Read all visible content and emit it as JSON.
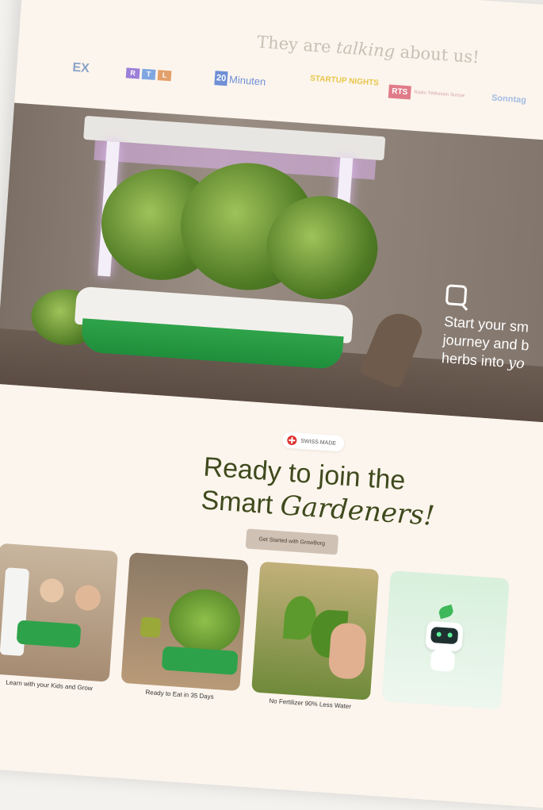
{
  "press": {
    "title_pre": "They are",
    "title_italic": "talking",
    "title_post": "about us!",
    "logos": {
      "ex": "EX",
      "rtl": [
        "R",
        "T",
        "L"
      ],
      "minuten_num": "20",
      "minuten_word": "Minuten",
      "startup": "STARTUP NIGHTS",
      "rts": "RTS",
      "rts_sub": "Radio Télévision Suisse",
      "sonntag": "Sonntag"
    }
  },
  "hero": {
    "line1": "Start your sm",
    "line2": "journey and b",
    "line3_pre": "herbs into",
    "line3_italic": "yo"
  },
  "badge": {
    "label": "SWISS MADE"
  },
  "headline": {
    "line1": "Ready to join the",
    "line2_pre": "Smart",
    "line2_italic": "Gardeners!"
  },
  "cta": {
    "label": "Get Started with GrowBorg"
  },
  "cards": [
    {
      "caption": "Learn with your Kids and Grow"
    },
    {
      "caption": "Ready to Eat in 35 Days"
    },
    {
      "caption": "No Fertilizer 90% Less Water"
    },
    {
      "caption": ""
    }
  ],
  "colors": {
    "background": "#fcf5ed",
    "headline": "#3f4a1d",
    "accent_green": "#1f8e3b",
    "cta_bg": "#cfc2b5"
  }
}
